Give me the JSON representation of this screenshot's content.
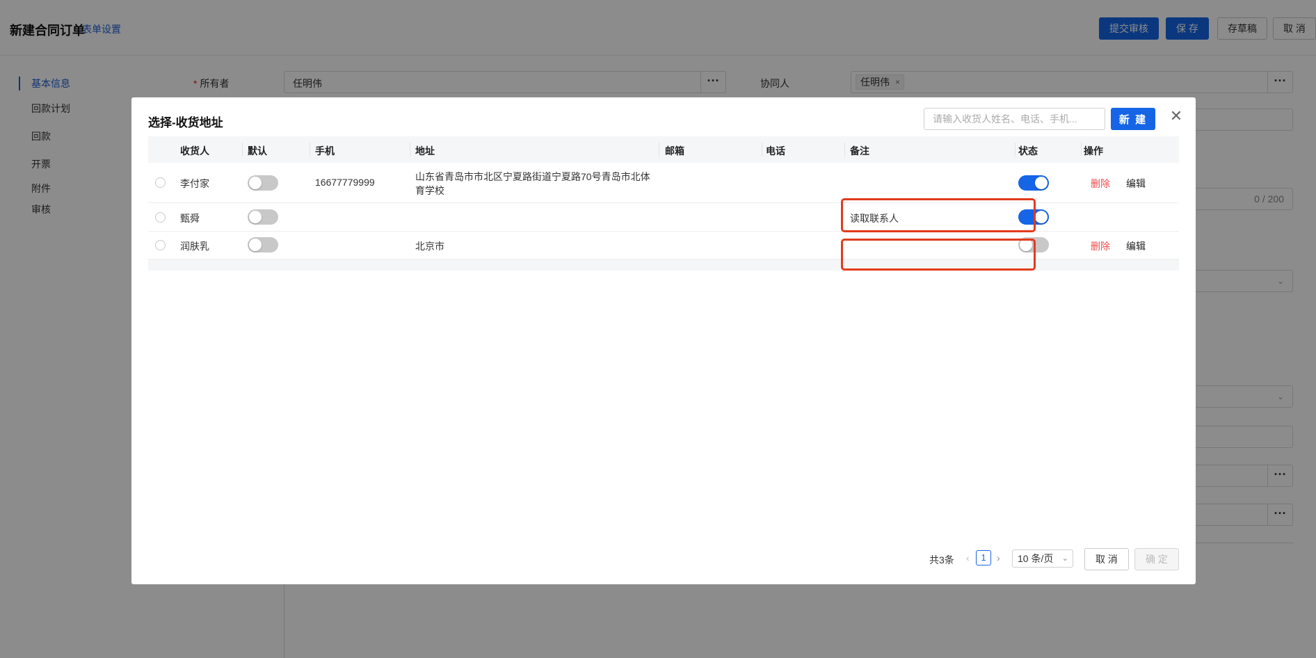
{
  "page": {
    "title": "新建合同订单",
    "form_settings": "表单设置",
    "buttons": {
      "submit": "提交审核",
      "save": "保 存",
      "draft": "存草稿",
      "cancel": "取 消"
    }
  },
  "sidenav": {
    "items": [
      {
        "label": "基本信息",
        "active": true
      },
      {
        "label": "回款计划"
      },
      {
        "label": "回款"
      },
      {
        "label": "开票"
      },
      {
        "label": "附件"
      },
      {
        "label": "审核"
      }
    ]
  },
  "form": {
    "owner_label": "所有者",
    "owner_value": "任明伟",
    "collaborator_label": "协同人",
    "collaborator_tag": "任明伟",
    "char_count": "0 / 200"
  },
  "modal": {
    "title": "选择-收货地址",
    "search_placeholder": "请输入收货人姓名、电话、手机...",
    "new_button": "新 建",
    "columns": [
      "收货人",
      "默认",
      "手机",
      "地址",
      "邮箱",
      "电话",
      "备注",
      "状态",
      "操作"
    ],
    "rows": [
      {
        "name": "李付家",
        "default": false,
        "mobile": "16677779999",
        "address": "山东省青岛市市北区宁夏路街道宁夏路70号青岛市北体育学校",
        "email": "",
        "phone": "",
        "remark": "",
        "status": true,
        "ops": {
          "delete": "删除",
          "edit": "编辑"
        }
      },
      {
        "name": "甄舜",
        "default": false,
        "mobile": "",
        "address": "",
        "email": "",
        "phone": "",
        "remark": "读取联系人",
        "status": true,
        "ops": null
      },
      {
        "name": "润肤乳",
        "default": false,
        "mobile": "",
        "address": "北京市",
        "email": "",
        "phone": "",
        "remark": "",
        "status": false,
        "ops": {
          "delete": "删除",
          "edit": "编辑"
        }
      }
    ],
    "pagination": {
      "total": "共3条",
      "current_page": "1",
      "page_size": "10 条/页"
    },
    "footer": {
      "cancel": "取 消",
      "confirm": "确 定"
    }
  },
  "colors": {
    "primary": "#1565e6",
    "danger": "#f04848",
    "highlight": "#e23b1c"
  }
}
